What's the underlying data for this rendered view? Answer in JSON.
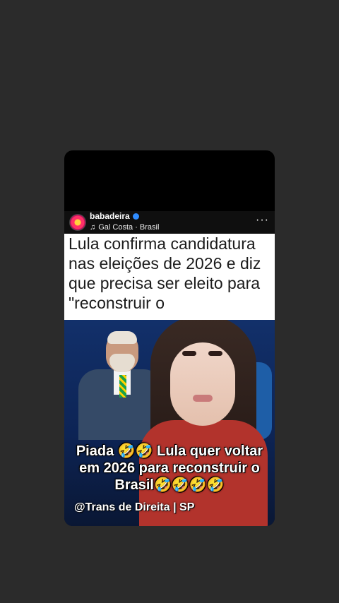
{
  "post": {
    "username": "babadeira",
    "audio": "Gal Costa · Brasil",
    "more": "···"
  },
  "headline": "Lula confirma candidatura\nnas eleições de 2026 e diz\nque precisa ser eleito para\n\"reconstruir o",
  "caption": "Piada 🤣🤣 Lula quer voltar\nem 2026 para reconstruir o\nBrasil🤣🤣🤣🤣",
  "watermark": "@Trans de Direita | SP",
  "icons": {
    "verified": "verified-badge-icon",
    "music": "music-note-icon",
    "more": "more-options-icon"
  },
  "colors": {
    "background": "#2b2b2b",
    "card": "#000000",
    "headline_bg": "#ffffff",
    "verified": "#2f8cff"
  }
}
